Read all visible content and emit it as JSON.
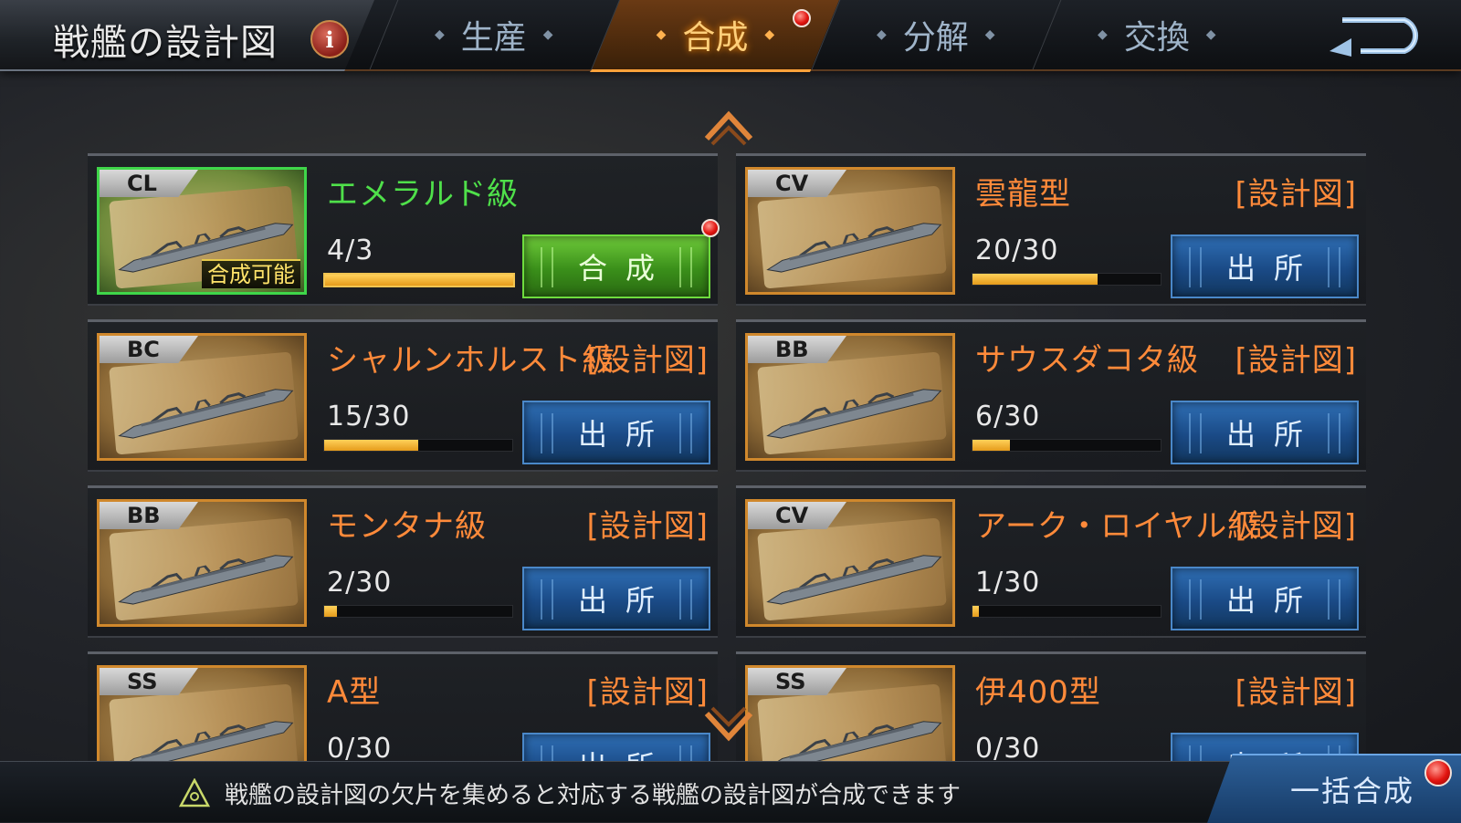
{
  "header": {
    "title": "戦艦の設計図",
    "info_icon": "i",
    "tabs": [
      {
        "label": "生産",
        "active": false
      },
      {
        "label": "合成",
        "active": true
      },
      {
        "label": "分解",
        "active": false
      },
      {
        "label": "交換",
        "active": false
      }
    ],
    "back_icon": "back-arrow-icon"
  },
  "cards": [
    {
      "type": "CL",
      "name": "エメラルド級",
      "tag": "",
      "count": "4/3",
      "progress": 1.0,
      "ready": true,
      "ready_badge": "合成可能",
      "button": "合成"
    },
    {
      "type": "CV",
      "name": "雲龍型",
      "tag": "[設計図]",
      "count": "20/30",
      "progress": 0.667,
      "ready": false,
      "button": "出所"
    },
    {
      "type": "BC",
      "name": "シャルンホルスト級",
      "tag": "[設計図]",
      "count": "15/30",
      "progress": 0.5,
      "ready": false,
      "button": "出所"
    },
    {
      "type": "BB",
      "name": "サウスダコタ級",
      "tag": "[設計図]",
      "count": "6/30",
      "progress": 0.2,
      "ready": false,
      "button": "出所"
    },
    {
      "type": "BB",
      "name": "モンタナ級",
      "tag": "[設計図]",
      "count": "2/30",
      "progress": 0.067,
      "ready": false,
      "button": "出所"
    },
    {
      "type": "CV",
      "name": "アーク・ロイヤル級",
      "tag": "[設計図]",
      "count": "1/30",
      "progress": 0.033,
      "ready": false,
      "button": "出所"
    },
    {
      "type": "SS",
      "name": "A型",
      "tag": "[設計図]",
      "count": "0/30",
      "progress": 0,
      "ready": false,
      "button": "出所"
    },
    {
      "type": "SS",
      "name": "伊400型",
      "tag": "[設計図]",
      "count": "0/30",
      "progress": 0,
      "ready": false,
      "button": "出所"
    }
  ],
  "footer": {
    "hint": "戦艦の設計図の欠片を集めると対応する戦艦の設計図が合成できます",
    "bulk_button": "一括合成"
  },
  "colors": {
    "accent_orange": "#ff8a3a",
    "ready_green": "#4fe04a",
    "button_blue": "#2f6fb5",
    "notification_red": "#e2140f"
  }
}
